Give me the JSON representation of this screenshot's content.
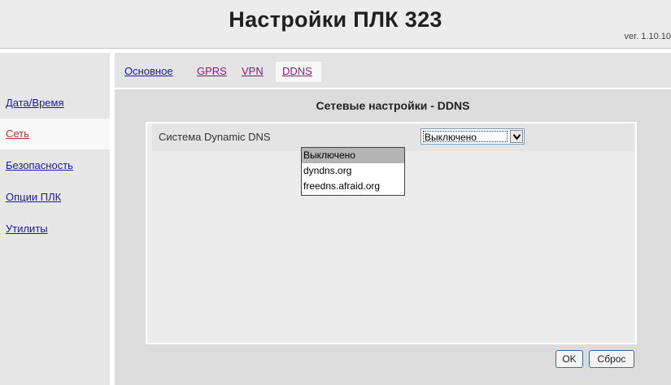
{
  "header": {
    "title": "Настройки ПЛК 323",
    "version": "ver. 1.10.10"
  },
  "sidebar": {
    "items": [
      {
        "label": "Дата/Время"
      },
      {
        "label": "Сеть"
      },
      {
        "label": "Безопасность"
      },
      {
        "label": "Опции ПЛК"
      },
      {
        "label": "Утилиты"
      }
    ],
    "active_index": 1
  },
  "tabs": [
    {
      "label": "Основное"
    },
    {
      "label": "GPRS"
    },
    {
      "label": "VPN"
    },
    {
      "label": "DDNS"
    }
  ],
  "active_tab": "DDNS",
  "main": {
    "section_title": "Сетевые настройки - DDNS",
    "ddns_field_label": "Система Dynamic DNS",
    "ddns_select_value": "Выключено",
    "ddns_options": [
      "Выключено",
      "dyndns.org",
      "freedns.afraid.org"
    ],
    "ddns_options_highlighted": 0
  },
  "buttons": {
    "ok_label": "OK",
    "reset_label": "Сброс"
  },
  "icons": {
    "select_arrow": "chevron-down-icon"
  },
  "colors": {
    "link": "#1a1aa6",
    "visited_link": "#7a1f7a",
    "active_sidebar_link": "#a23b2e",
    "button_border": "#3c6aa8"
  }
}
